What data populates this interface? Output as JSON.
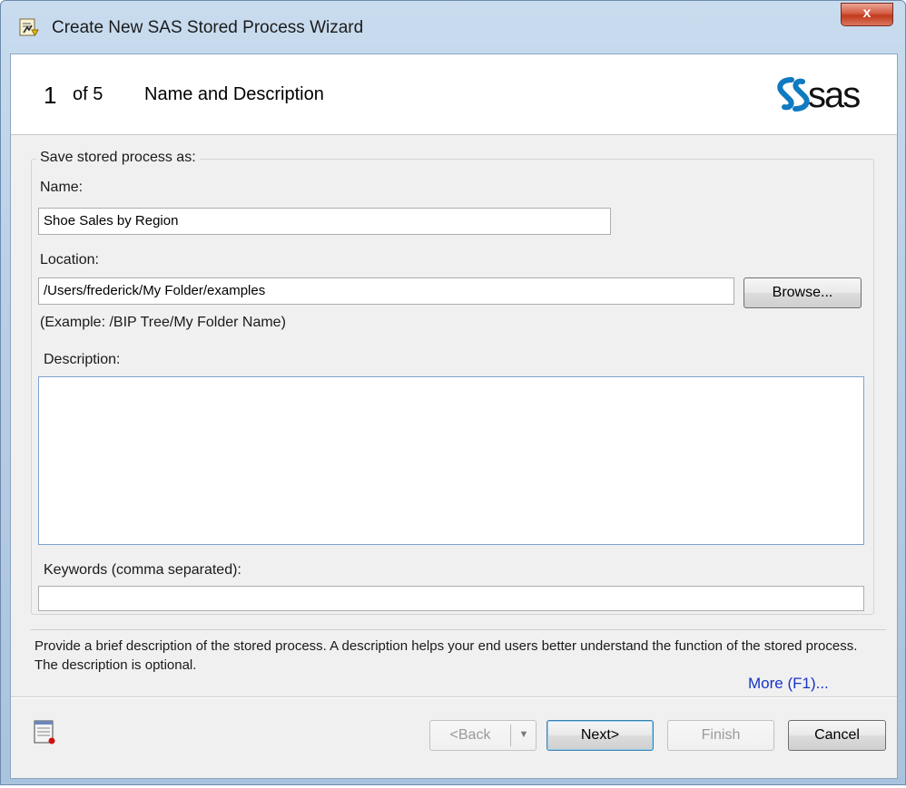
{
  "window": {
    "title": "Create New SAS Stored Process Wizard",
    "close_label": "x"
  },
  "header": {
    "step_number": "1",
    "step_of": "of 5",
    "step_title": "Name and Description",
    "logo_text": "sas"
  },
  "form": {
    "group_label": "Save stored process as:",
    "name_label": "Name:",
    "name_value": "Shoe Sales by Region",
    "location_label": "Location:",
    "location_value": "/Users/frederick/My Folder/examples",
    "browse_label": "Browse...",
    "location_example": "(Example: /BIP Tree/My Folder Name)",
    "description_label": "Description:",
    "description_value": "",
    "keywords_label": "Keywords (comma separated):",
    "keywords_value": ""
  },
  "help": {
    "text": "Provide a brief description of the stored process. A description helps your end users better understand the function of the stored process. The description is optional.",
    "more_link": "More (F1)..."
  },
  "footer": {
    "back_label": "<Back",
    "next_label": "Next>",
    "finish_label": "Finish",
    "cancel_label": "Cancel"
  },
  "colors": {
    "link": "#1633c9",
    "sas_logo": "#0f7ac0",
    "close_button": "#c23a1c"
  },
  "icons": [
    "app-wizard-icon",
    "close-icon",
    "sas-logo",
    "dropdown-arrow-icon",
    "notes-icon"
  ]
}
